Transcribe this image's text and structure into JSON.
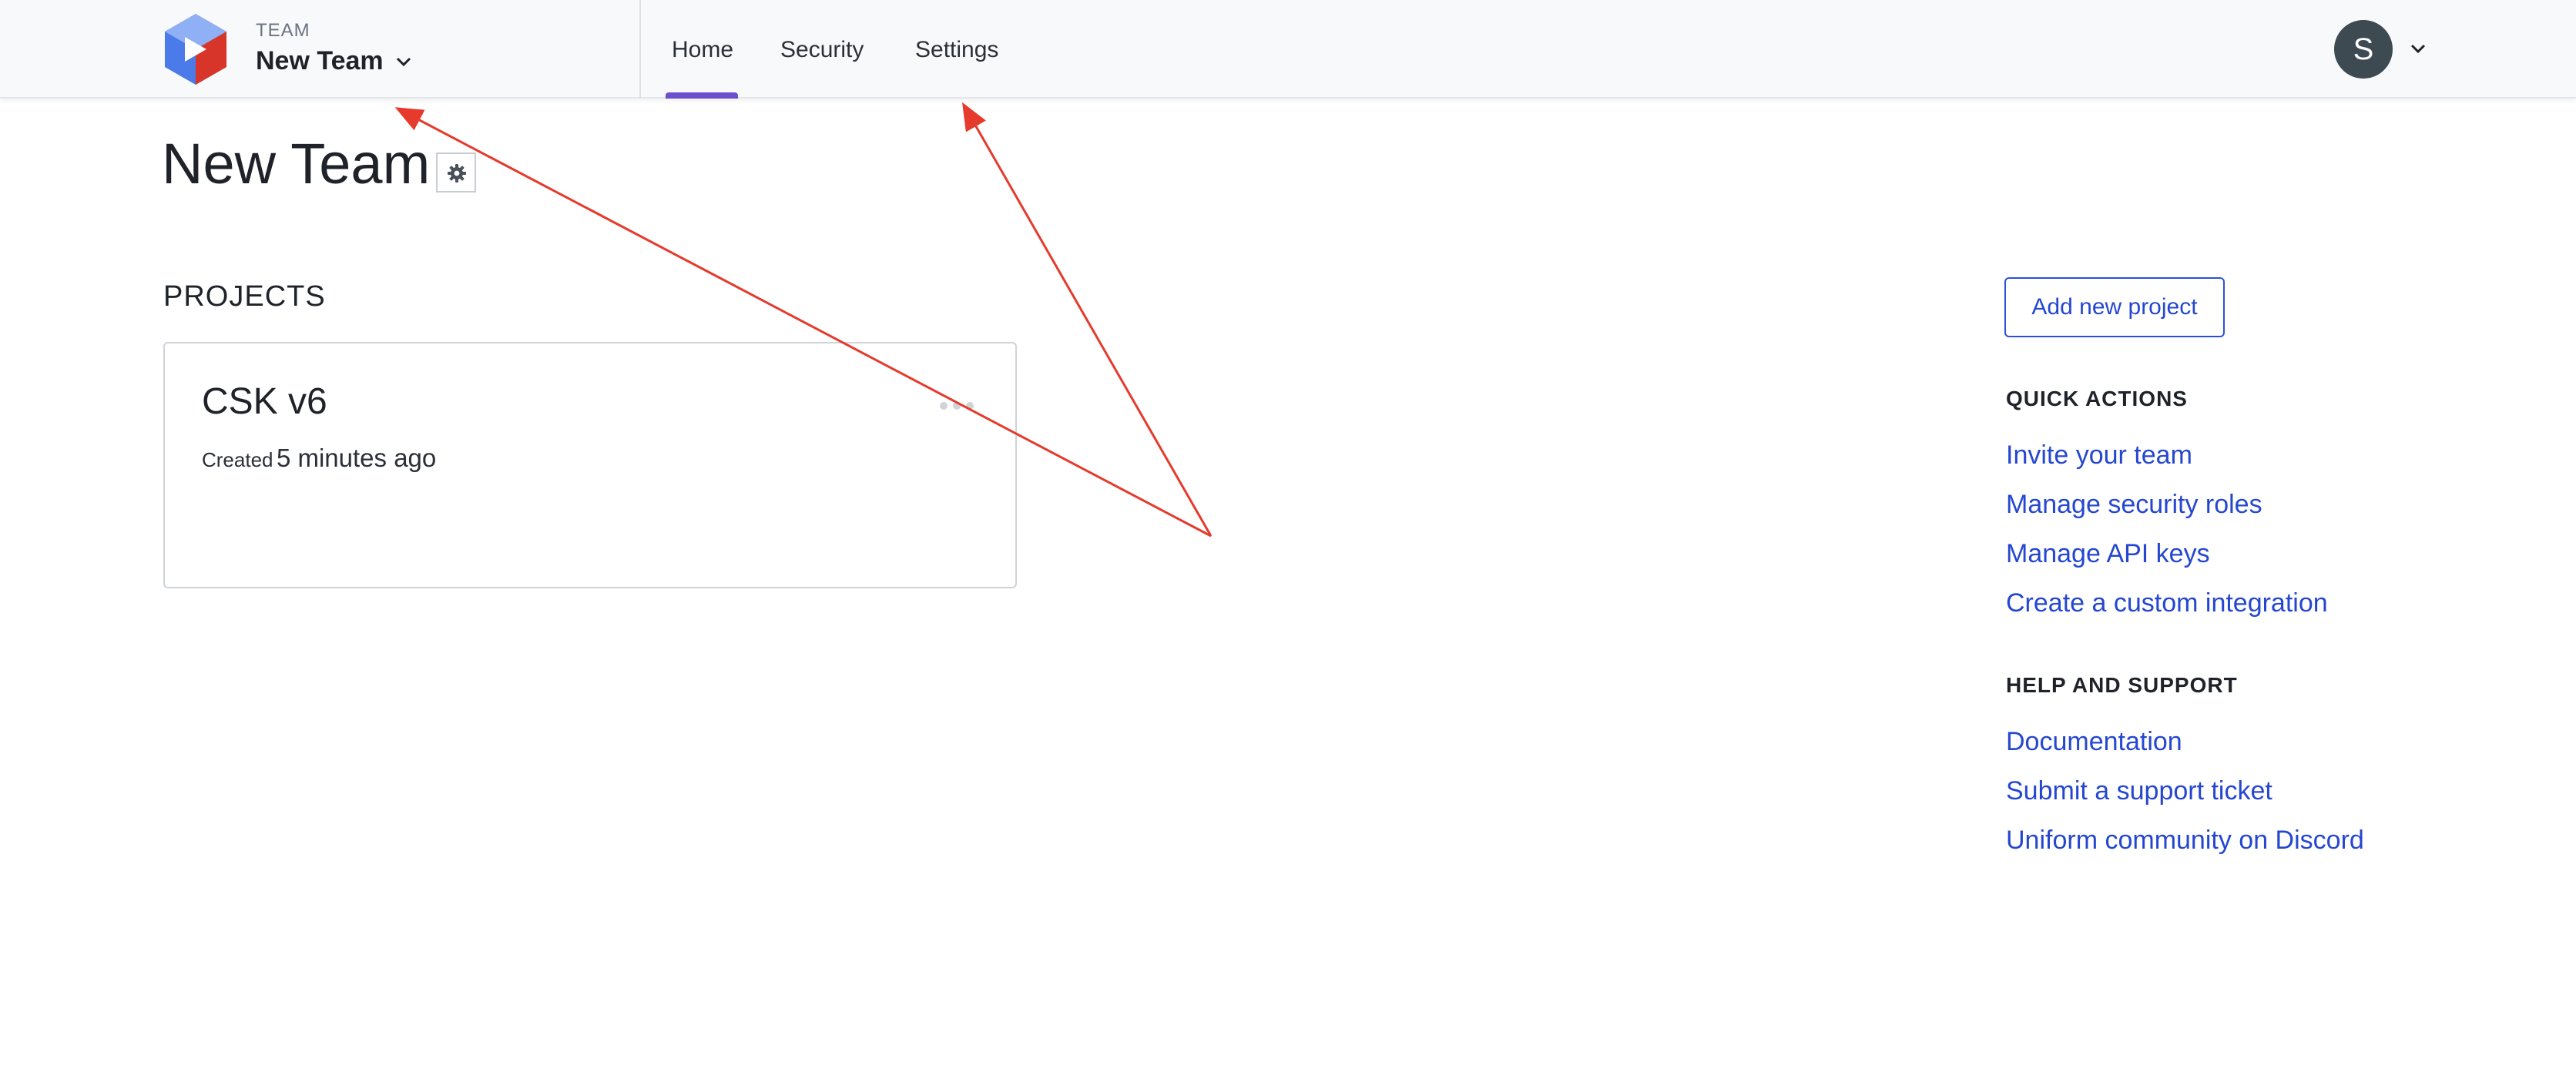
{
  "header": {
    "team_caption": "TEAM",
    "team_name": "New Team",
    "nav": [
      {
        "label": "Home",
        "active": true
      },
      {
        "label": "Security"
      },
      {
        "label": "Settings"
      }
    ],
    "user_initial": "S"
  },
  "main": {
    "title": "New Team",
    "projects_heading": "PROJECTS",
    "projects": [
      {
        "name": "CSK v6",
        "created_label": "Created",
        "created_value": "5 minutes ago"
      }
    ]
  },
  "sidebar": {
    "add_project_label": "Add new project",
    "quick_actions_heading": "QUICK ACTIONS",
    "quick_actions": [
      "Invite your team",
      "Manage security roles",
      "Manage API keys",
      "Create a custom integration"
    ],
    "help_heading": "HELP AND SUPPORT",
    "help_links": [
      "Documentation",
      "Submit a support ticket",
      "Uniform community on Discord"
    ]
  },
  "colors": {
    "accent": "#6b4fce",
    "link": "#2547d0",
    "annotation": "#e53a2c"
  }
}
